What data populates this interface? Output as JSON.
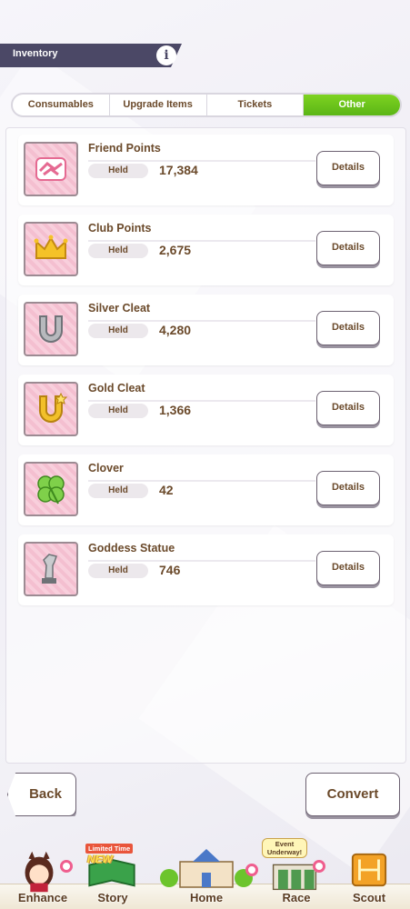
{
  "header": {
    "title": "Inventory",
    "info_glyph": "i"
  },
  "tabs": [
    {
      "label": "Consumables",
      "active": false
    },
    {
      "label": "Upgrade Items",
      "active": false
    },
    {
      "label": "Tickets",
      "active": false
    },
    {
      "label": "Other",
      "active": true
    }
  ],
  "held_label": "Held",
  "details_label": "Details",
  "items": [
    {
      "name": "Friend Points",
      "count": "17,384",
      "icon": "handshake-icon"
    },
    {
      "name": "Club Points",
      "count": "2,675",
      "icon": "crown-icon"
    },
    {
      "name": "Silver Cleat",
      "count": "4,280",
      "icon": "silver-horseshoe-icon"
    },
    {
      "name": "Gold Cleat",
      "count": "1,366",
      "icon": "gold-horseshoe-icon"
    },
    {
      "name": "Clover",
      "count": "42",
      "icon": "clover-icon"
    },
    {
      "name": "Goddess Statue",
      "count": "746",
      "icon": "statue-icon"
    }
  ],
  "footer": {
    "back_label": "Back",
    "convert_label": "Convert"
  },
  "nav": {
    "items": [
      {
        "label": "Enhance",
        "icon": "horse-girl-icon"
      },
      {
        "label": "Story",
        "icon": "book-icon",
        "badge_top": "Limited Time",
        "badge_new": "NEW"
      },
      {
        "label": "Home",
        "icon": "building-icon"
      },
      {
        "label": "Race",
        "icon": "gate-icon",
        "badge_event": "Event Underway!"
      },
      {
        "label": "Scout",
        "icon": "scout-icon"
      }
    ]
  },
  "colors": {
    "accent_green": "#6cc41c",
    "header_bar": "#4b4866",
    "text_brown": "#6b4a2b",
    "item_icon_bg": "#f6c8d6"
  }
}
